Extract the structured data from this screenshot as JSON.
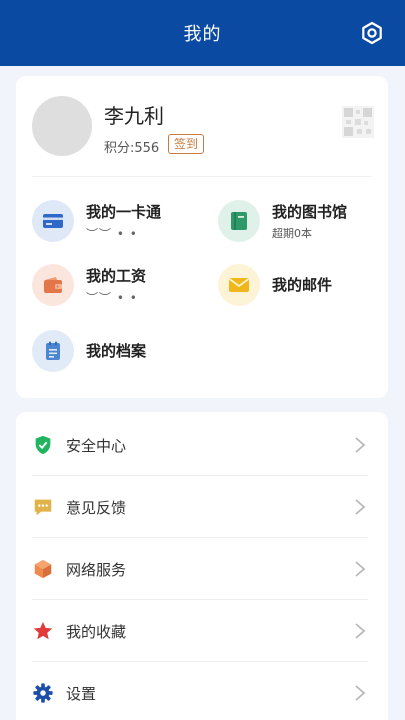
{
  "header": {
    "title": "我的",
    "settings_icon": "gear-icon"
  },
  "profile": {
    "name": "李九利",
    "points": "积分:556",
    "checkin_label": "签到"
  },
  "functions": [
    {
      "title": "我的一卡通",
      "sub": "︶︶ • •",
      "icon": "card-icon",
      "color": "#2f69c8",
      "bg": "#dfe8f6"
    },
    {
      "title": "我的图书馆",
      "sub": "超期0本",
      "icon": "book-icon",
      "color": "#2e9a6a",
      "bg": "#dff1e8"
    },
    {
      "title": "我的工资",
      "sub": "︶︶ • •",
      "icon": "wallet-icon",
      "color": "#e4774a",
      "bg": "#fbe6dd"
    },
    {
      "title": "我的邮件",
      "sub": "",
      "icon": "mail-icon",
      "color": "#f0b71d",
      "bg": "#fdf3d7"
    },
    {
      "title": "我的档案",
      "sub": "",
      "icon": "archive-icon",
      "color": "#4c86d0",
      "bg": "#e1eaf7"
    }
  ],
  "menu": [
    {
      "label": "安全中心",
      "icon": "shield-icon",
      "color": "#22b35e"
    },
    {
      "label": "意见反馈",
      "icon": "feedback-icon",
      "color": "#e0b24a"
    },
    {
      "label": "网络服务",
      "icon": "cube-icon",
      "color": "#ee8a4c"
    },
    {
      "label": "我的收藏",
      "icon": "star-icon",
      "color": "#e03a3a"
    },
    {
      "label": "设置",
      "icon": "settings-icon",
      "color": "#1e4fa8"
    }
  ]
}
